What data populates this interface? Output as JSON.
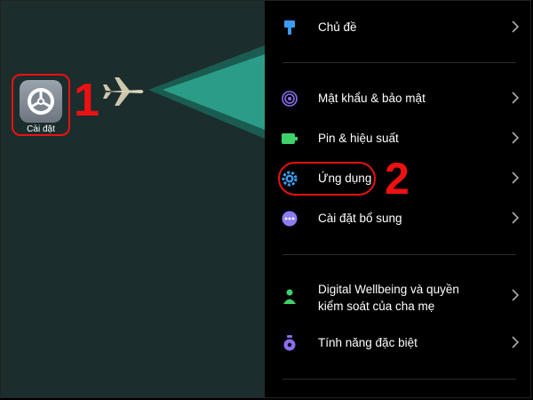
{
  "home": {
    "app_label": "Cài đặt",
    "step_1": "1",
    "step_2": "2"
  },
  "settings": {
    "items": [
      {
        "label": "Chủ đề",
        "icon": "brush-icon"
      },
      {
        "label": "Mật khẩu & bảo mật",
        "icon": "fingerprint-icon"
      },
      {
        "label": "Pin & hiệu suất",
        "icon": "battery-icon"
      },
      {
        "label": "Ứng dụng",
        "icon": "gear-icon"
      },
      {
        "label": "Cài đặt bổ sung",
        "icon": "more-icon"
      },
      {
        "label": "Digital Wellbeing và quyền kiểm soát của cha mẹ",
        "icon": "wellbeing-icon"
      },
      {
        "label": "Tính năng đặc biệt",
        "icon": "special-features-icon"
      }
    ]
  },
  "colors": {
    "accent_red": "#ee1111",
    "teal_cone": "#2a9c87",
    "blue_icon": "#3b9cf5",
    "green_icon": "#3fd26a",
    "purple_icon": "#8b6cf0"
  }
}
